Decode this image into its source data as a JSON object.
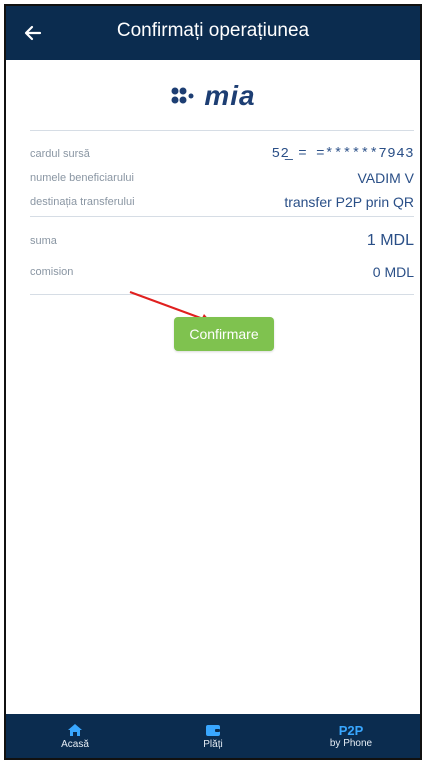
{
  "header": {
    "title": "Confirmați operațiunea"
  },
  "brand": {
    "name": "mia",
    "accent": "#1d3e73"
  },
  "details": {
    "rows": [
      {
        "label": "cardul sursă",
        "value": "52̲ ⁣= ⁣=******7943"
      },
      {
        "label": "numele beneficiarului",
        "value": "VADIM V"
      },
      {
        "label": "destinația transferului",
        "value": "transfer P2P prin QR"
      }
    ],
    "amount": {
      "label": "suma",
      "value": "1 MDL"
    },
    "fee": {
      "label": "comision",
      "value": "0 MDL"
    }
  },
  "actions": {
    "confirm_label": "Confirmare",
    "confirm_color": "#7fc24f"
  },
  "nav": {
    "background": "#0b2c4f",
    "items": [
      {
        "icon": "home-icon",
        "label": "Acasă"
      },
      {
        "icon": "wallet-icon",
        "label": "Plăți"
      },
      {
        "main": "P2P",
        "label": "by Phone"
      }
    ]
  }
}
